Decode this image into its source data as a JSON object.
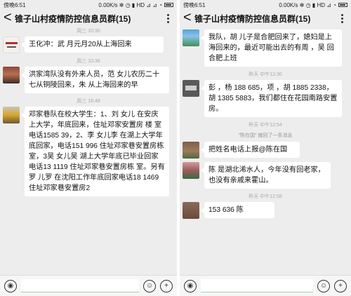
{
  "left": {
    "status_time": "傍晚6:51",
    "status_right": "0.00K/s ✻ ◷ ▮ HD ⊿ ⊿ ◔",
    "title": "锥子山村疫情防控信息员群(15)",
    "back_glyph": "<",
    "time1": "周三 10:30",
    "msg1": "王化冲：武  月元月20从上海回来",
    "time2": "周三 10:36",
    "msg2": "洪家湾队没有外来人员，范  女儿农历二十七从铜陵回来，朱  从上海回来的早",
    "time3": "周三 16:48",
    "msg3": "邓家巷队在校大学生：1、刘  女儿  在安庆上大学，年底回来，住址邓家安置房  楼  室电话1585  39，2、李  女儿李  在湖上大学年底回家，电话151  996 住址邓家巷安置房栋  室，3吴  女儿吴  湖上大学年底已毕业回家电话13  1119 住址邓家巷安置房栋  室。另有罗  儿罗  在沈阳工作年底回家电话18  1469 住址邓家巷安置房2"
  },
  "right": {
    "status_time": "傍晚6:51",
    "status_right": "0.00K/s ✻ ◷ ▮ HD ⊿ ◔",
    "title": "锥子山村疫情防控信息员群(15)",
    "back_glyph": "<",
    "msg1": "我队，胡  儿子是合肥回来了，媳妇是上海回来的，最近可能出去的有周  ，吴  回合肥上班",
    "time1": "昨天 中午12:30",
    "msg2": "彭  ，杨  188  685，项  ，胡  1885  2338，胡  1385  5883，我们都住在花园南路安置房。",
    "time2": "昨天 中午12:54",
    "sysnote": "\"陈在国\" 撤回了一条消息",
    "msg3": "把姓名电话上报@陈在国",
    "msg4": "陈  是湖北浠水人，今年没有回老家，也没有亲戚来霍山。",
    "time3": "昨天 中午12:58",
    "msg5": "153  636 陈"
  },
  "input": {
    "voice_icon": "voice-icon",
    "emoji_icon": "emoji-icon",
    "plus_icon": "plus-icon"
  },
  "colors": {
    "chat_bg": "#ededed",
    "bubble": "#ffffff",
    "input_underline": "#9ad59a"
  }
}
